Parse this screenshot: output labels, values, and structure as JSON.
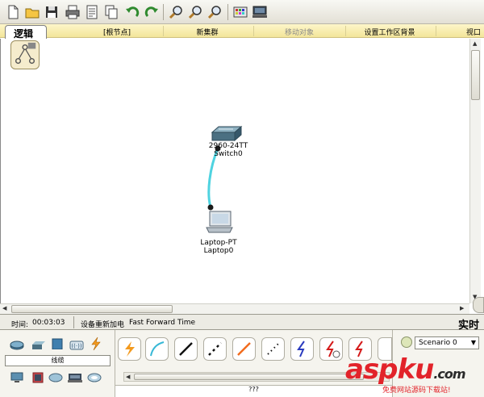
{
  "toolbar": {
    "buttons": [
      "new-icon",
      "open-icon",
      "save-icon",
      "print-icon",
      "activity-wizard-icon",
      "copy-icon",
      "undo-icon",
      "redo-icon",
      "zoom-in-icon",
      "zoom-reset-icon",
      "zoom-out-icon",
      "palette-icon",
      "custom-device-icon"
    ]
  },
  "workspace_bar": {
    "logical_tab": "逻辑",
    "root_label": "[根节点]",
    "new_cluster": "新集群",
    "move_object": "移动对象",
    "set_bg": "设置工作区背景",
    "viewport": "视口"
  },
  "canvas": {
    "devices": [
      {
        "model": "2960-24TT",
        "name": "Switch0"
      },
      {
        "model": "Laptop-PT",
        "name": "Laptop0"
      }
    ],
    "link_color": "#4fd3e0"
  },
  "statusbar": {
    "time_label": "时间:",
    "time_value": "00:03:03",
    "power_cycle": "设备重新加电",
    "fast_forward": "Fast Forward Time",
    "mode": "实时"
  },
  "bottom": {
    "category_label": "线缆",
    "cable_description": "???",
    "scenario": "Scenario 0"
  },
  "watermark": {
    "main": "aspku",
    "tld": ".com",
    "sub": "免费网站源码下载站!"
  }
}
